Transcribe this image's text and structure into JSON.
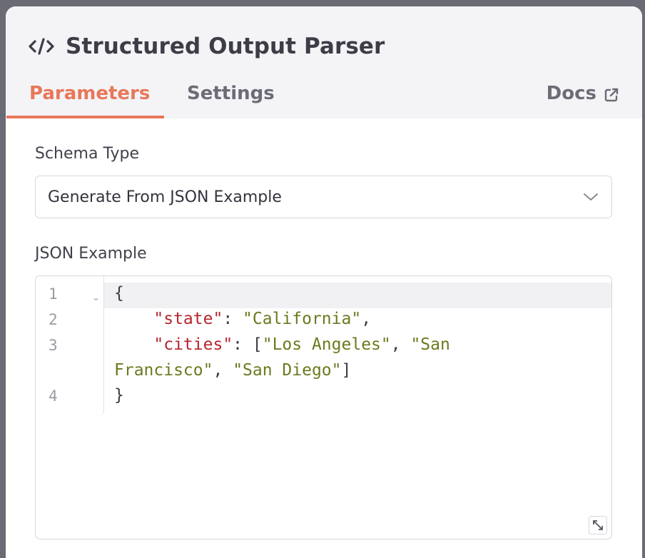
{
  "header": {
    "title": "Structured Output Parser",
    "icon": "code-icon"
  },
  "tabs": [
    {
      "label": "Parameters",
      "active": true
    },
    {
      "label": "Settings",
      "active": false
    }
  ],
  "docs": {
    "label": "Docs",
    "icon": "external-link-icon"
  },
  "schema_type": {
    "label": "Schema Type",
    "value": "Generate From JSON Example"
  },
  "json_example": {
    "label": "JSON Example",
    "line_numbers": [
      "1",
      "2",
      "3",
      "4"
    ],
    "lines": {
      "open": "{",
      "state_key": "\"state\"",
      "state_value": "\"California\"",
      "cities_key": "\"cities\"",
      "city1": "\"Los Angeles\"",
      "city2a": "\"San",
      "city2b": "Francisco\"",
      "city3": "\"San Diego\"",
      "close": "}"
    }
  },
  "colors": {
    "accent": "#e8775a",
    "json_key": "#b5262f",
    "json_string": "#6b7a1e"
  }
}
